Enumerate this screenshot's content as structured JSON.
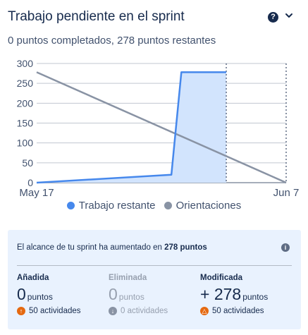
{
  "header": {
    "title": "Trabajo pendiente en el sprint",
    "help_icon": "question-circle-icon",
    "menu_icon": "chevron-down-icon"
  },
  "summary": "0 puntos completados, 278 puntos restantes",
  "chart_data": {
    "type": "line",
    "ylim": [
      0,
      300
    ],
    "y_ticks": [
      "0",
      "50",
      "100",
      "150",
      "200",
      "250",
      "300"
    ],
    "x_start_label": "May 17",
    "x_end_label": "Jun 7",
    "series": [
      {
        "name": "Trabajo restante",
        "color": "#4688ec",
        "fill": "#d2e4fd",
        "points": [
          [
            0,
            0
          ],
          [
            0.54,
            20
          ],
          [
            0.58,
            278
          ],
          [
            0.76,
            278
          ]
        ]
      },
      {
        "name": "Orientaciones",
        "color": "#8993a4",
        "points": [
          [
            0,
            278
          ],
          [
            1,
            0
          ]
        ]
      }
    ],
    "markers": [
      0.76,
      1
    ]
  },
  "scope": {
    "prefix": "El alcance de tu sprint ha aumentado en ",
    "amount": "278 puntos"
  },
  "stats": [
    {
      "label": "Añadida",
      "value": "0",
      "unit": "puntos",
      "activities": "50 actividades",
      "icon_color": "#e56910",
      "icon": "arrow-up-icon"
    },
    {
      "label": "Eliminada",
      "value": "0",
      "unit": "puntos",
      "activities": "0 actividades",
      "icon_color": "#8993a4",
      "icon": "arrow-down-icon"
    },
    {
      "label": "Modificada",
      "value": "+ 278",
      "unit": "puntos",
      "activities": "50 actividades",
      "icon_color": "#e56910",
      "icon": "delta-icon"
    }
  ]
}
